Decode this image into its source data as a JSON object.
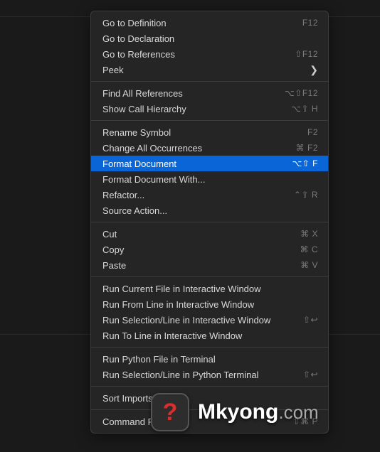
{
  "menu": {
    "groups": [
      [
        {
          "label": "Go to Definition",
          "shortcut": "F12",
          "submenu": false
        },
        {
          "label": "Go to Declaration",
          "shortcut": "",
          "submenu": false
        },
        {
          "label": "Go to References",
          "shortcut": "⇧F12",
          "submenu": false
        },
        {
          "label": "Peek",
          "shortcut": "",
          "submenu": true
        }
      ],
      [
        {
          "label": "Find All References",
          "shortcut": "⌥⇧F12",
          "submenu": false
        },
        {
          "label": "Show Call Hierarchy",
          "shortcut": "⌥⇧ H",
          "submenu": false
        }
      ],
      [
        {
          "label": "Rename Symbol",
          "shortcut": "F2",
          "submenu": false
        },
        {
          "label": "Change All Occurrences",
          "shortcut": "⌘ F2",
          "submenu": false
        },
        {
          "label": "Format Document",
          "shortcut": "⌥⇧ F",
          "submenu": false,
          "selected": true
        },
        {
          "label": "Format Document With...",
          "shortcut": "",
          "submenu": false
        },
        {
          "label": "Refactor...",
          "shortcut": "⌃⇧ R",
          "submenu": false
        },
        {
          "label": "Source Action...",
          "shortcut": "",
          "submenu": false
        }
      ],
      [
        {
          "label": "Cut",
          "shortcut": "⌘ X",
          "submenu": false
        },
        {
          "label": "Copy",
          "shortcut": "⌘ C",
          "submenu": false
        },
        {
          "label": "Paste",
          "shortcut": "⌘ V",
          "submenu": false
        }
      ],
      [
        {
          "label": "Run Current File in Interactive Window",
          "shortcut": "",
          "submenu": false
        },
        {
          "label": "Run From Line in Interactive Window",
          "shortcut": "",
          "submenu": false
        },
        {
          "label": "Run Selection/Line in Interactive Window",
          "shortcut": "⇧↩",
          "submenu": false
        },
        {
          "label": "Run To Line in Interactive Window",
          "shortcut": "",
          "submenu": false
        }
      ],
      [
        {
          "label": "Run Python File in Terminal",
          "shortcut": "",
          "submenu": false
        },
        {
          "label": "Run Selection/Line in Python Terminal",
          "shortcut": "⇧↩",
          "submenu": false
        }
      ],
      [
        {
          "label": "Sort Imports",
          "shortcut": "",
          "submenu": false
        }
      ],
      [
        {
          "label": "Command Palette...",
          "shortcut": "⇧⌘ P",
          "submenu": false
        }
      ]
    ]
  },
  "watermark": {
    "badge": "?",
    "brand": "Mkyong",
    "suffix": ".com"
  }
}
